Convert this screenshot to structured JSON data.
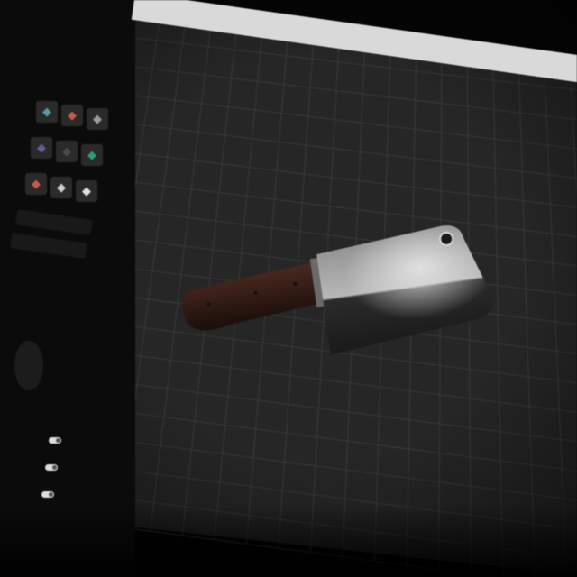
{
  "window": {
    "title": "",
    "url": ""
  },
  "menu": {
    "items": [
      "",
      "",
      "",
      ""
    ]
  },
  "sidebar": {
    "header": "",
    "section_label": "",
    "buttons": [
      "",
      ""
    ],
    "options_label": "",
    "options_sub": "",
    "toggles": [
      {
        "label": "",
        "on": true
      },
      {
        "label": "",
        "on": true
      },
      {
        "label": "",
        "on": true
      }
    ],
    "footer": ""
  },
  "thumbnails": [
    {
      "icon": "cleaver-thumb-icon",
      "color": "#4aa0a8"
    },
    {
      "icon": "cleaver-thumb-icon",
      "color": "#c85a4a"
    },
    {
      "icon": "cleaver-thumb-icon",
      "color": "#9a9a9a"
    },
    {
      "icon": "cleaver-thumb-icon",
      "color": "#6a5a9a"
    },
    {
      "icon": "cleaver-thumb-icon",
      "color": "#4a4a4a"
    },
    {
      "icon": "cleaver-thumb-icon",
      "color": "#2aa070"
    },
    {
      "icon": "cleaver-thumb-icon",
      "color": "#c85a4a"
    },
    {
      "icon": "cleaver-thumb-icon",
      "color": "#cfcfcf"
    },
    {
      "icon": "cleaver-thumb-icon",
      "color": "#e0e0e0"
    }
  ],
  "model": {
    "name": "",
    "icon": "meat-cleaver-3d-model"
  },
  "colors": {
    "grid": "#3a3a3a",
    "background": "#1f1f1f",
    "handle": "#3a1e16",
    "blade": "#9a9a9a"
  }
}
